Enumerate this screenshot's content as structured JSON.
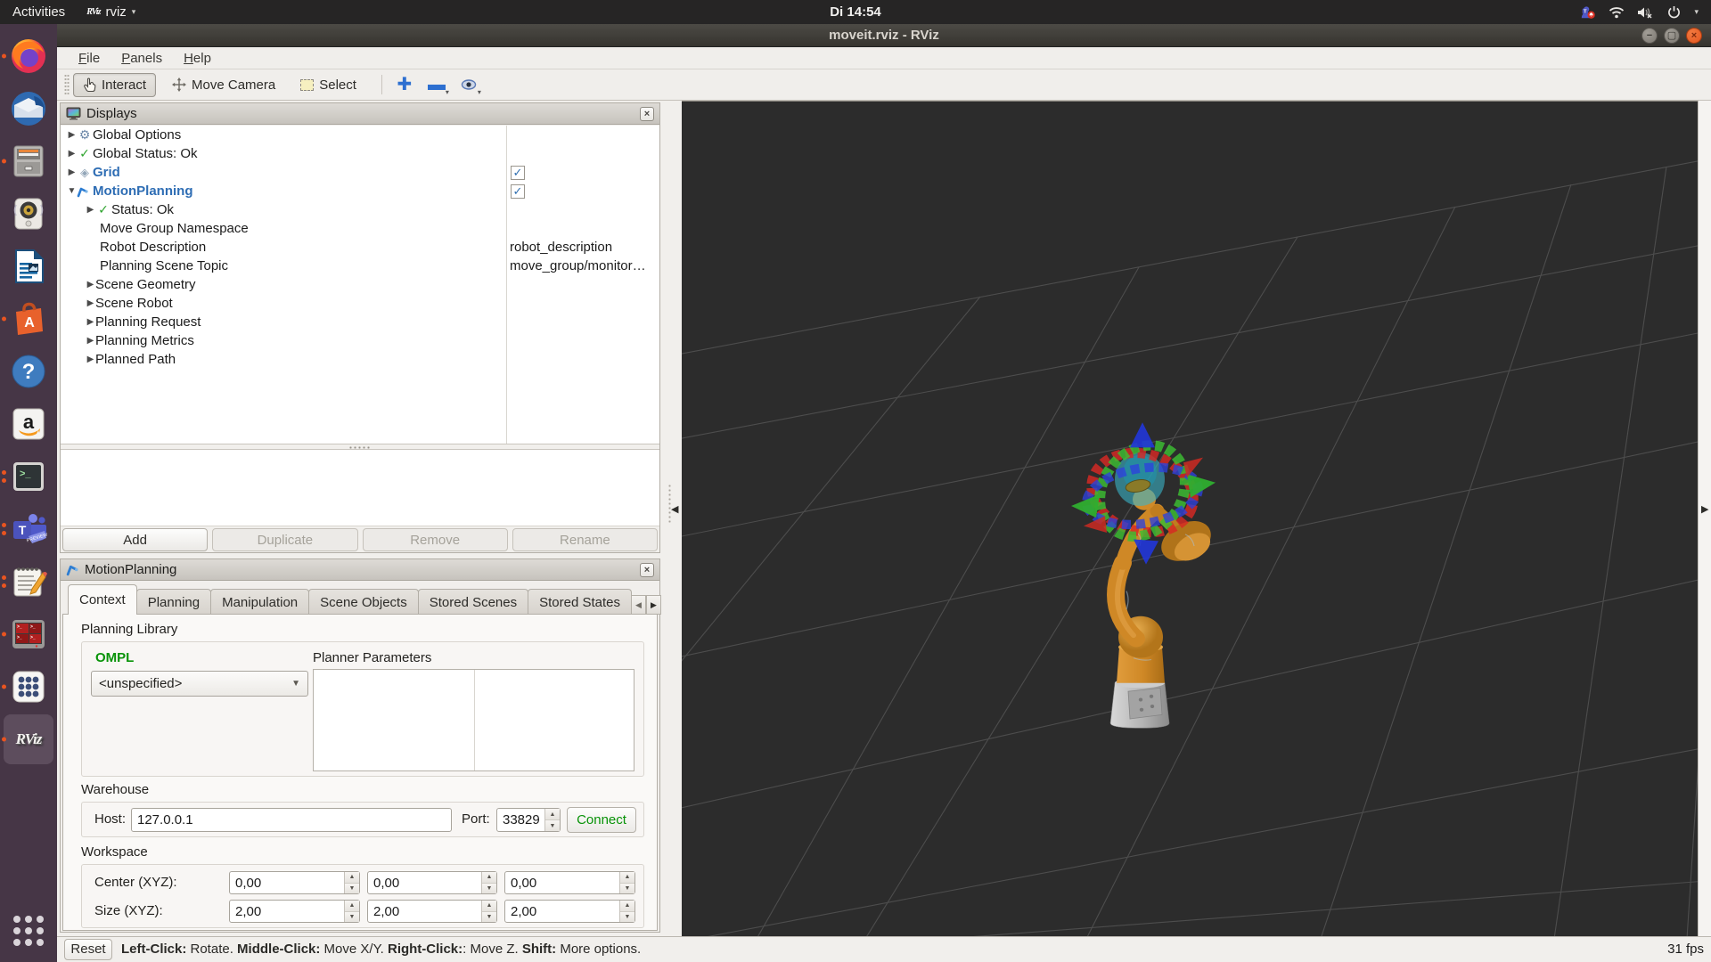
{
  "topbar": {
    "activities_label": "Activities",
    "app_menu_label": "rviz",
    "clock": "Di 14:54"
  },
  "titlebar": {
    "title": "moveit.rviz - RViz"
  },
  "menubar": {
    "items": [
      "File",
      "Panels",
      "Help"
    ]
  },
  "toolbar": {
    "interact": "Interact",
    "move_camera": "Move Camera",
    "select": "Select"
  },
  "dock": {
    "items": [
      {
        "icon": "firefox-icon",
        "dots": 1
      },
      {
        "icon": "thunderbird-icon",
        "dots": 0
      },
      {
        "icon": "file-cabinet-icon",
        "dots": 1
      },
      {
        "icon": "rhythmbox-icon",
        "dots": 0
      },
      {
        "icon": "libreoffice-writer-icon",
        "dots": 0
      },
      {
        "icon": "ubuntu-software-icon",
        "dots": 1
      },
      {
        "icon": "help-icon",
        "dots": 0
      },
      {
        "icon": "amazon-icon",
        "dots": 0
      },
      {
        "icon": "terminal-icon",
        "dots": 2
      },
      {
        "icon": "teams-icon",
        "dots": 2
      },
      {
        "icon": "text-editor-icon",
        "dots": 2
      },
      {
        "icon": "terminator-icon",
        "dots": 1
      },
      {
        "icon": "app-grid-icon",
        "dots": 1
      },
      {
        "icon": "rviz-icon",
        "dots": 1,
        "label": "RViz",
        "active": true
      }
    ]
  },
  "displays": {
    "title": "Displays",
    "tree": [
      {
        "label": "Global Options"
      },
      {
        "label": "Global Status: Ok"
      },
      {
        "label": "Grid",
        "checked": true
      },
      {
        "label": "MotionPlanning",
        "checked": true
      },
      {
        "label": "Status: Ok"
      },
      {
        "label": "Move Group Namespace",
        "value": ""
      },
      {
        "label": "Robot Description",
        "value": "robot_description"
      },
      {
        "label": "Planning Scene Topic",
        "value": "move_group/monitor…"
      },
      {
        "label": "Scene Geometry"
      },
      {
        "label": "Scene Robot"
      },
      {
        "label": "Planning Request"
      },
      {
        "label": "Planning Metrics"
      },
      {
        "label": "Planned Path"
      }
    ],
    "buttons": [
      {
        "label": "Add",
        "enabled": true
      },
      {
        "label": "Duplicate",
        "enabled": false
      },
      {
        "label": "Remove",
        "enabled": false
      },
      {
        "label": "Rename",
        "enabled": false
      }
    ],
    "checkmark": "✓"
  },
  "motionplanning": {
    "title": "MotionPlanning",
    "tabs": [
      "Context",
      "Planning",
      "Manipulation",
      "Scene Objects",
      "Stored Scenes",
      "Stored States"
    ],
    "context": {
      "planning_library_label": "Planning Library",
      "library_name": "OMPL",
      "planner_combo_value": "<unspecified>",
      "planner_parameters_label": "Planner Parameters",
      "warehouse_label": "Warehouse",
      "host_label": "Host:",
      "host_value": "127.0.0.1",
      "port_label": "Port:",
      "port_value": "33829",
      "connect_label": "Connect",
      "workspace_label": "Workspace",
      "center_label": "Center (XYZ):",
      "center_values": [
        "0,00",
        "0,00",
        "0,00"
      ],
      "size_label": "Size (XYZ):",
      "size_values": [
        "2,00",
        "2,00",
        "2,00"
      ]
    }
  },
  "statusbar": {
    "reset_label": "Reset",
    "segments": [
      {
        "key": "Left-Click:",
        "desc": " Rotate. "
      },
      {
        "key": "Middle-Click:",
        "desc": " Move X/Y. "
      },
      {
        "key": "Right-Click:",
        "desc": ": Move Z. "
      },
      {
        "key": "Shift:",
        "desc": " More options."
      }
    ],
    "fps": "31 fps"
  }
}
